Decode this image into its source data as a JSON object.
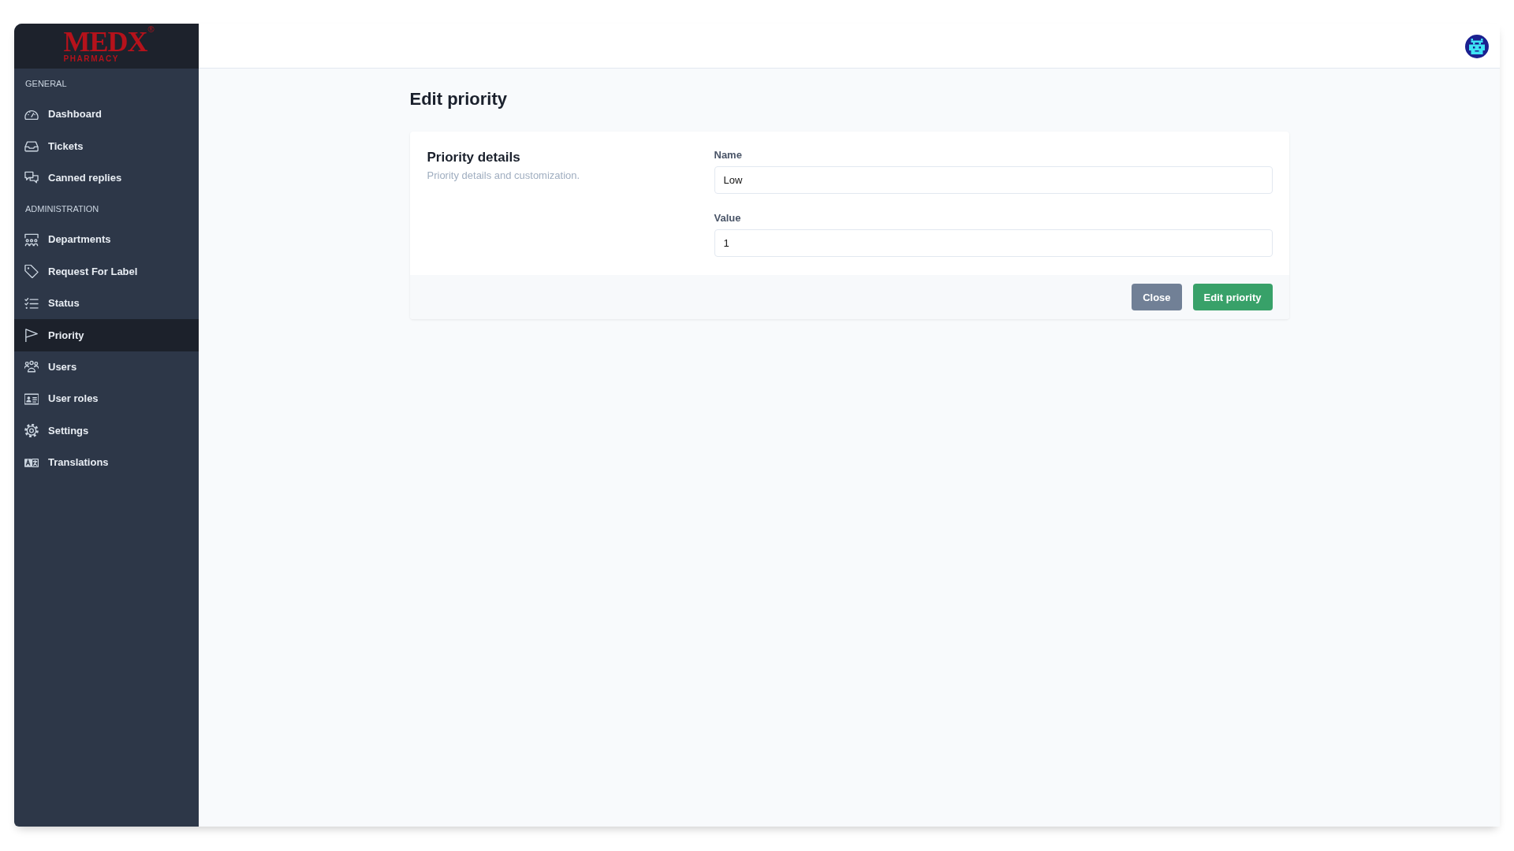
{
  "sidebar": {
    "logo": {
      "wordmark": "MEDX",
      "tagline": "PHARMACY",
      "registered_mark": "®"
    },
    "sections": [
      {
        "heading": "GENERAL",
        "items": [
          {
            "label": "Dashboard",
            "selected": false
          },
          {
            "label": "Tickets",
            "selected": false
          },
          {
            "label": "Canned replies",
            "selected": false
          }
        ]
      },
      {
        "heading": "ADMINISTRATION",
        "items": [
          {
            "label": "Departments",
            "selected": false
          },
          {
            "label": "Request For Label",
            "selected": false
          },
          {
            "label": "Status",
            "selected": false
          },
          {
            "label": "Priority",
            "selected": true
          },
          {
            "label": "Users",
            "selected": false
          },
          {
            "label": "User roles",
            "selected": false
          },
          {
            "label": "Settings",
            "selected": false
          },
          {
            "label": "Translations",
            "selected": false
          }
        ]
      }
    ]
  },
  "page": {
    "title": "Edit priority"
  },
  "form": {
    "section_title": "Priority details",
    "section_description": "Priority details and customization.",
    "fields": [
      {
        "label": "Name",
        "value": "Low"
      },
      {
        "label": "Value",
        "value": "1"
      }
    ],
    "buttons": [
      {
        "label": "Close",
        "kind": "secondary"
      },
      {
        "label": "Edit priority",
        "kind": "primary"
      }
    ]
  }
}
